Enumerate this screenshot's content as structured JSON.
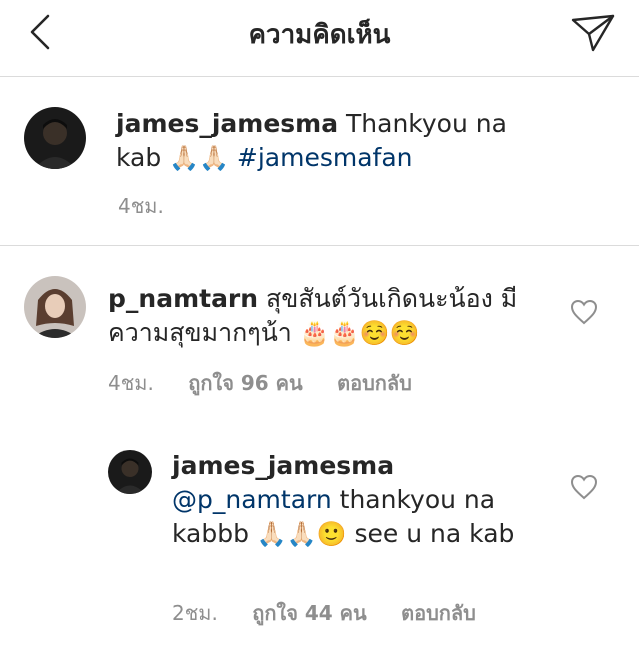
{
  "header": {
    "title": "ความคิดเห็น",
    "back_icon": "chevron-left-icon",
    "send_icon": "paper-plane-icon"
  },
  "caption": {
    "username": "james_jamesma",
    "text_1": " Thankyou na kab ",
    "emoji_1": "🙏🏻🙏🏻",
    "hashtag": "#jamesmafan",
    "time": "4ชม."
  },
  "comment": {
    "username": "p_namtarn",
    "text": " สุขสันต์วันเกิดนะน้อง มีความสุขมากๆน้า ",
    "emoji": "🎂🎂☺️☺️",
    "time": "4ชม.",
    "likes": "ถูกใจ 96 คน",
    "reply_label": "ตอบกลับ"
  },
  "reply": {
    "username": "james_jamesma",
    "mention": "@p_namtarn",
    "text_1": " thankyou na kabbb ",
    "emoji": "🙏🏻🙏🏻🙂",
    "text_2": " see u na kab",
    "time": "2ชม.",
    "likes": "ถูกใจ 44 คน",
    "reply_label": "ตอบกลับ"
  },
  "colors": {
    "link": "#003569",
    "meta": "#8e8e8e",
    "divider": "#dbdbdb"
  }
}
